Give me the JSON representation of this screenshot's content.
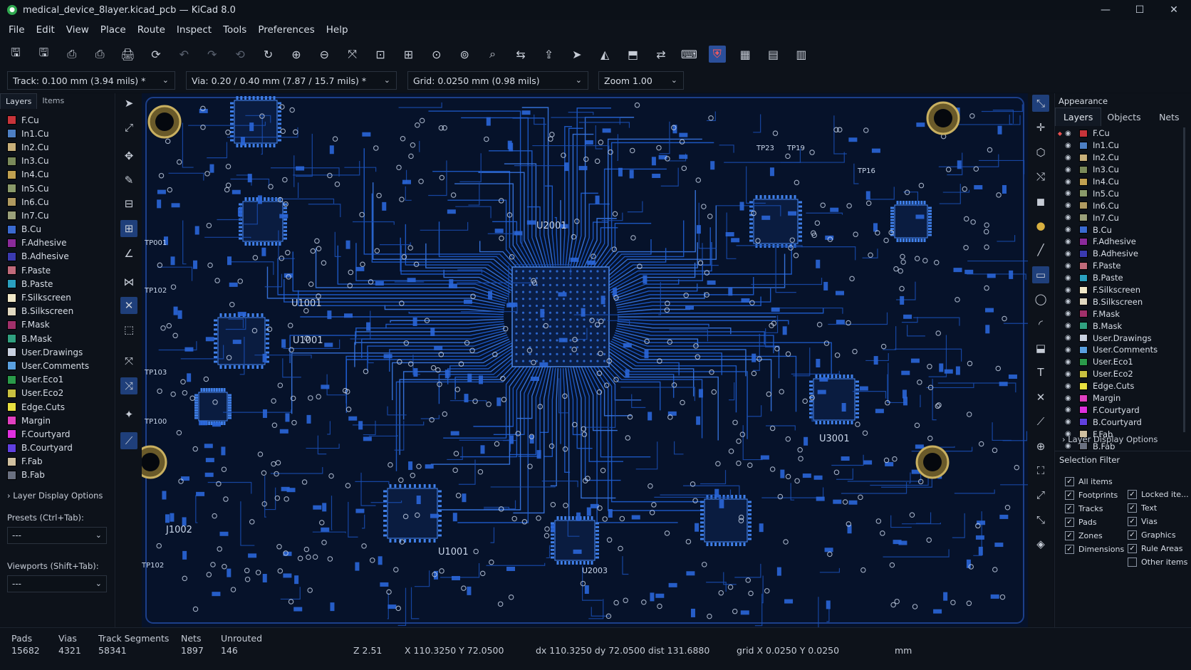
{
  "window": {
    "title": "medical_device_8layer.kicad_pcb — KiCad 8.0",
    "minimize": "—",
    "maximize": "☐",
    "close": "✕"
  },
  "menu": [
    "File",
    "Edit",
    "View",
    "Place",
    "Route",
    "Inspect",
    "Tools",
    "Preferences",
    "Help"
  ],
  "toolbar_icons": [
    "save-board-icon",
    "save-icon",
    "page-settings-icon",
    "print-icon",
    "plot-icon",
    "refresh-icon",
    "undo-icon",
    "redo-icon",
    "zoom-redraw-icon",
    "rotate-icon",
    "zoom-in-icon",
    "zoom-out-icon",
    "zoom-fit-icon",
    "zoom-objects-icon",
    "zoom-area-icon",
    "zoom-center-icon",
    "zoom-selection-icon",
    "zoom-tool-icon",
    "flip-icon",
    "upload-icon",
    "route-icon",
    "mirror-icon",
    "footprint-editor-icon",
    "update-pcb-icon",
    "scripting-icon",
    "drc-icon",
    "net-inspector-icon",
    "show-ratsnest-icon",
    "3d-viewer-icon"
  ],
  "combos": {
    "track": "Track: 0.100 mm (3.94 mils) *",
    "via": "Via: 0.20 / 0.40 mm (7.87 / 15.7 mils) *",
    "grid": "Grid: 0.0250 mm (0.98 mils)",
    "zoom": "Zoom 1.00"
  },
  "left_panel": {
    "tabs": [
      "Layers",
      "Items"
    ],
    "layers": [
      {
        "name": "F.Cu",
        "color": "#c8343a"
      },
      {
        "name": "In1.Cu",
        "color": "#4d7fc4"
      },
      {
        "name": "In2.Cu",
        "color": "#c8b07a"
      },
      {
        "name": "In3.Cu",
        "color": "#7a8a5a"
      },
      {
        "name": "In4.Cu",
        "color": "#c0a050"
      },
      {
        "name": "In5.Cu",
        "color": "#8a9a6a"
      },
      {
        "name": "In6.Cu",
        "color": "#b09a60"
      },
      {
        "name": "In7.Cu",
        "color": "#9aa07a"
      },
      {
        "name": "B.Cu",
        "color": "#3a6ad0"
      },
      {
        "name": "F.Adhesive",
        "color": "#8a2a9a"
      },
      {
        "name": "B.Adhesive",
        "color": "#3a3ab0"
      },
      {
        "name": "F.Paste",
        "color": "#c06a7a"
      },
      {
        "name": "B.Paste",
        "color": "#2aa0c0"
      },
      {
        "name": "F.Silkscreen",
        "color": "#f0e8c8"
      },
      {
        "name": "B.Silkscreen",
        "color": "#e0d8c0"
      },
      {
        "name": "F.Mask",
        "color": "#a0306a"
      },
      {
        "name": "B.Mask",
        "color": "#30a080"
      },
      {
        "name": "User.Drawings",
        "color": "#c8d0e0"
      },
      {
        "name": "User.Comments",
        "color": "#5aa0e0"
      },
      {
        "name": "User.Eco1",
        "color": "#2a9a4a"
      },
      {
        "name": "User.Eco2",
        "color": "#c8c040"
      },
      {
        "name": "Edge.Cuts",
        "color": "#e8e040"
      },
      {
        "name": "Margin",
        "color": "#e040c0"
      },
      {
        "name": "F.Courtyard",
        "color": "#e030e0"
      },
      {
        "name": "B.Courtyard",
        "color": "#6040e0"
      },
      {
        "name": "F.Fab",
        "color": "#d0c0a0"
      },
      {
        "name": "B.Fab",
        "color": "#6a7080"
      }
    ],
    "layer_display_options": "› Layer Display Options",
    "presets_label": "Presets (Ctrl+Tab):",
    "presets_value": "---",
    "viewports_label": "Viewports (Shift+Tab):",
    "viewports_value": "---"
  },
  "canvas_refs": [
    {
      "text": "U2001",
      "id": "u2001"
    },
    {
      "text": "U1001",
      "id": "u1001-a"
    },
    {
      "text": "U1001",
      "id": "u1001-b"
    },
    {
      "text": "U1001",
      "id": "u1001-c"
    },
    {
      "text": "U3001",
      "id": "u3001"
    },
    {
      "text": "U2003",
      "id": "u2003"
    },
    {
      "text": "J1002",
      "id": "j1002"
    },
    {
      "text": "TP102",
      "id": "tp102"
    },
    {
      "text": "TP100",
      "id": "tp100"
    },
    {
      "text": "TP103",
      "id": "tp103"
    },
    {
      "text": "TP001",
      "id": "tp001"
    },
    {
      "text": "TP102",
      "id": "tp102b"
    },
    {
      "text": "TP23",
      "id": "tp23"
    },
    {
      "text": "TP19",
      "id": "tp19"
    },
    {
      "text": "TP16",
      "id": "tp16"
    }
  ],
  "right_panel": {
    "title": "Appearance",
    "tabs": [
      "Layers",
      "Objects",
      "Nets"
    ],
    "layers": [
      "F.Cu",
      "In1.Cu",
      "In2.Cu",
      "In3.Cu",
      "In4.Cu",
      "In5.Cu",
      "In6.Cu",
      "In7.Cu",
      "B.Cu",
      "F.Adhesive",
      "B.Adhesive",
      "F.Paste",
      "B.Paste",
      "F.Silkscreen",
      "B.Silkscreen",
      "F.Mask",
      "B.Mask",
      "User.Drawings",
      "User.Comments",
      "User.Eco1",
      "User.Eco2",
      "Edge.Cuts",
      "Margin",
      "F.Courtyard",
      "B.Courtyard",
      "F.Fab",
      "B.Fab"
    ],
    "layer_display_options": "› Layer Display Options",
    "selection_filter": "Selection Filter",
    "filters_left": [
      "All items",
      "Footprints",
      "Tracks",
      "Pads",
      "Zones",
      "Dimensions"
    ],
    "filters_right": [
      "Locked ite...",
      "Text",
      "Vias",
      "Graphics",
      "Rule Areas",
      "Other items"
    ]
  },
  "status": {
    "pads_label": "Pads",
    "pads": "15682",
    "vias_label": "Vias",
    "vias": "4321",
    "tracks_label": "Track Segments",
    "tracks": "58341",
    "nets_label": "Nets",
    "nets": "1897",
    "unrouted_label": "Unrouted",
    "unrouted": "146",
    "z": "Z 2.51",
    "xy": "X 110.3250  Y 72.0500",
    "delta": "dx 110.3250  dy 72.0500  dist 131.6880",
    "grid": "grid X 0.0250  Y 0.0250",
    "units": "mm"
  }
}
